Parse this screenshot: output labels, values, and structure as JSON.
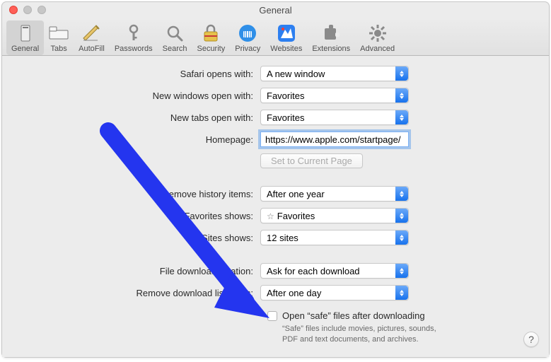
{
  "window": {
    "title": "General"
  },
  "toolbar": {
    "items": [
      {
        "label": "General"
      },
      {
        "label": "Tabs"
      },
      {
        "label": "AutoFill"
      },
      {
        "label": "Passwords"
      },
      {
        "label": "Search"
      },
      {
        "label": "Security"
      },
      {
        "label": "Privacy"
      },
      {
        "label": "Websites"
      },
      {
        "label": "Extensions"
      },
      {
        "label": "Advanced"
      }
    ]
  },
  "form": {
    "opens_with": {
      "label": "Safari opens with:",
      "value": "A new window"
    },
    "new_windows": {
      "label": "New windows open with:",
      "value": "Favorites"
    },
    "new_tabs": {
      "label": "New tabs open with:",
      "value": "Favorites"
    },
    "homepage": {
      "label": "Homepage:",
      "value": "https://www.apple.com/startpage/"
    },
    "set_current": "Set to Current Page",
    "remove_history": {
      "label": "Remove history items:",
      "value": "After one year"
    },
    "favorites_shows": {
      "label": "Favorites shows:",
      "value": "Favorites"
    },
    "top_sites": {
      "label": "Top Sites shows:",
      "value": "12 sites"
    },
    "download_location": {
      "label": "File download location:",
      "value": "Ask for each download"
    },
    "remove_downloads": {
      "label": "Remove download list items:",
      "value": "After one day"
    },
    "safe_files": {
      "label": "Open “safe” files after downloading",
      "sub": "“Safe” files include movies, pictures, sounds, PDF and text documents, and archives."
    }
  },
  "help": "?"
}
